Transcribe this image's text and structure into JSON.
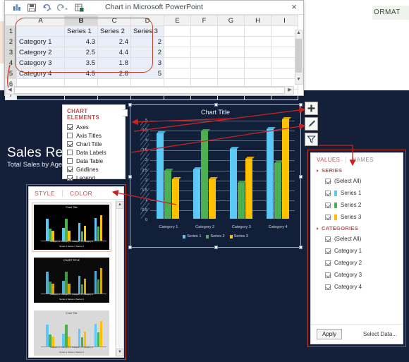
{
  "sheet": {
    "title": "Chart in Microsoft PowerPoint",
    "close_label": "×",
    "quick_access": [
      "chart-icon",
      "save-icon",
      "undo-icon",
      "redo-icon",
      "excel-icon"
    ],
    "columns": [
      "A",
      "B",
      "C",
      "D",
      "E",
      "F",
      "G",
      "H",
      "I"
    ],
    "rows": [
      "1",
      "2",
      "3",
      "4",
      "5",
      "6",
      "7"
    ],
    "header_row": [
      "",
      "Series 1",
      "Series 2",
      "Series 3"
    ],
    "data_rows": [
      {
        "label": "Category 1",
        "values": [
          "4.3",
          "2.4",
          "2"
        ]
      },
      {
        "label": "Category 2",
        "values": [
          "2.5",
          "4.4",
          "2"
        ]
      },
      {
        "label": "Category 3",
        "values": [
          "3.5",
          "1.8",
          "3"
        ]
      },
      {
        "label": "Category 4",
        "values": [
          "4.5",
          "2.8",
          "5"
        ]
      }
    ]
  },
  "ribbon": {
    "format_tab": "ORMAT"
  },
  "slide": {
    "title": "Sales Rep",
    "subtitle": "Total Sales by Agent",
    "background": "#14203a"
  },
  "chart_elements": {
    "title": "CHART ELEMENTS",
    "items": [
      {
        "label": "Axes",
        "checked": true
      },
      {
        "label": "Axis Titles",
        "checked": false
      },
      {
        "label": "Chart Title",
        "checked": true
      },
      {
        "label": "Data Labels",
        "checked": false
      },
      {
        "label": "Data Table",
        "checked": false
      },
      {
        "label": "Gridlines",
        "checked": true
      },
      {
        "label": "Legend",
        "checked": true
      }
    ]
  },
  "chart_buttons": [
    {
      "name": "chart-elements-button",
      "icon": "plus-icon"
    },
    {
      "name": "chart-styles-button",
      "icon": "brush-icon"
    },
    {
      "name": "chart-filters-button",
      "icon": "funnel-icon"
    }
  ],
  "style_panel": {
    "tabs": [
      "STYLE",
      "COLOR"
    ],
    "selected_tab": "STYLE",
    "thumbnails": [
      {
        "name": "style-thumbnail-1",
        "title": "Chart Title",
        "selected": true,
        "bg": "#000000",
        "text": "#ffffff"
      },
      {
        "name": "style-thumbnail-2",
        "title": "CHART TITLE",
        "selected": false,
        "bg": "#0b0b0b",
        "text": "#ffffff"
      },
      {
        "name": "style-thumbnail-3",
        "title": "Chart Title",
        "selected": false,
        "bg": "#d9d9d9",
        "text": "#333333"
      }
    ],
    "scroll_up": "▲",
    "scroll_down": "▼"
  },
  "filter_pane": {
    "tabs": [
      {
        "label": "VALUES",
        "active": true
      },
      {
        "label": "NAMES",
        "active": false
      }
    ],
    "series_header": "SERIES",
    "categories_header": "CATEGORIES",
    "series_items": [
      {
        "label": "(Select All)",
        "checked": true,
        "color": null
      },
      {
        "label": "Series 1",
        "checked": true,
        "color": "#5BC8F5"
      },
      {
        "label": "Series 2",
        "checked": true,
        "color": "#4CAF50"
      },
      {
        "label": "Series 3",
        "checked": true,
        "color": "#FFC000"
      }
    ],
    "category_items": [
      {
        "label": "(Select All)",
        "checked": true
      },
      {
        "label": "Category 1",
        "checked": true
      },
      {
        "label": "Category 2",
        "checked": true
      },
      {
        "label": "Category 3",
        "checked": true
      },
      {
        "label": "Category 4",
        "checked": true
      }
    ],
    "apply_label": "Apply",
    "select_data_label": "Select Data..."
  },
  "chart_data": {
    "type": "bar",
    "title": "Chart Title",
    "xlabel": "",
    "ylabel": "",
    "ylim": [
      0,
      5
    ],
    "yticks": [
      "0",
      "0.5",
      "1",
      "1.5",
      "2",
      "2.5",
      "3",
      "3.5",
      "4",
      "4.5",
      "5"
    ],
    "grid": true,
    "legend_position": "bottom",
    "categories": [
      "Category 1",
      "Category 2",
      "Category 3",
      "Category 4"
    ],
    "series": [
      {
        "name": "Series 1",
        "color": "#5BC8F5",
        "values": [
          4.3,
          2.5,
          3.5,
          4.5
        ]
      },
      {
        "name": "Series 2",
        "color": "#4CAF50",
        "values": [
          2.4,
          4.4,
          1.8,
          2.8
        ]
      },
      {
        "name": "Series 3",
        "color": "#FFC000",
        "values": [
          2,
          2,
          3,
          5
        ]
      }
    ]
  }
}
